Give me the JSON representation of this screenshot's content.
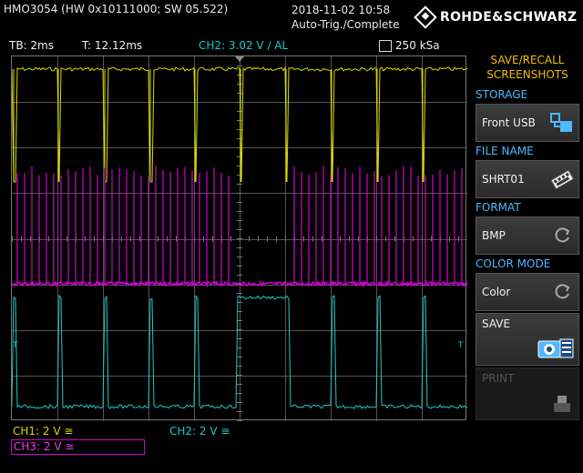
{
  "header": {
    "model": "HMO3054 (HW 0x10111000; SW 05.522)",
    "date": "2018-11-02 10:58",
    "trigger_status": "Auto-Trig./Complete",
    "brand": "ROHDE&SCHWARZ"
  },
  "status": {
    "timebase": "TB: 2ms",
    "trigger_time": "T: 12.12ms",
    "trigger_level": "CH2: 3.02 V ∕ AL",
    "sample_rate": "250 kSa"
  },
  "markers": {
    "ch1": "1",
    "ch3": "3",
    "ch2": "2",
    "trigger_left": "T",
    "trigger_right": "T"
  },
  "channels": {
    "ch1": "CH1: 2 V ≅",
    "ch2": "CH2: 2 V ≅",
    "ch3": "CH3: 2 V ≅"
  },
  "colors": {
    "ch1": "#d8d800",
    "ch2": "#20c8c8",
    "ch3": "#d400d4",
    "accent": "#f0c000",
    "section": "#4fb8ff"
  },
  "menu": {
    "title": "SAVE/RECALL SCREENSHOTS",
    "storage_label": "STORAGE",
    "storage_value": "Front USB",
    "storage_icon": "usb-storage-icon",
    "file_name_label": "FILE NAME",
    "file_name_value": "SHRT01",
    "file_name_icon": "keyboard-icon",
    "format_label": "FORMAT",
    "format_value": "BMP",
    "color_mode_label": "COLOR MODE",
    "color_mode_value": "Color",
    "save_label": "SAVE",
    "save_icon": "camera-icon",
    "print_label": "PRINT",
    "print_icon": "printer-icon"
  }
}
